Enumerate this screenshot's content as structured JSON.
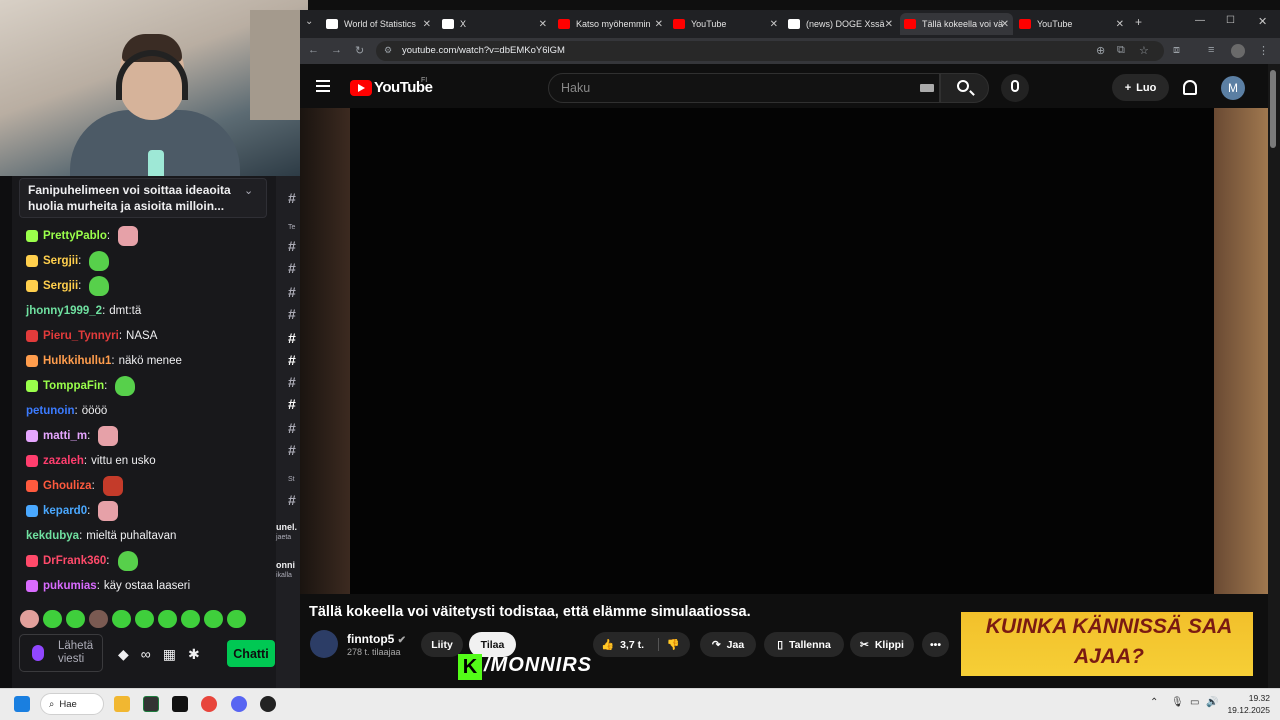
{
  "chat": {
    "pinned_message": "Fanipuhelimeen voi soittaa ideaoita huolia murheita ja asioita milloin...",
    "messages": [
      {
        "user": "PrettyPablo",
        "text": "",
        "color": "#9aff4b",
        "emote": "pink"
      },
      {
        "user": "Sergjii",
        "text": "",
        "color": "#ffcf4d",
        "emote": "green"
      },
      {
        "user": "Sergjii",
        "text": "",
        "color": "#ffcf4d",
        "emote": "green"
      },
      {
        "user": "jhonny1999_2",
        "text": "dmt:tä",
        "color": "#6fe0a0",
        "emote": ""
      },
      {
        "user": "Pieru_Tynnyri",
        "text": "NASA",
        "color": "#e23b3b",
        "emote": ""
      },
      {
        "user": "Hulkkihullu1",
        "text": "näkö menee",
        "color": "#ff9d4d",
        "emote": ""
      },
      {
        "user": "TomppaFin",
        "text": "",
        "color": "#9aff4b",
        "emote": "green"
      },
      {
        "user": "petunoin",
        "text": "öööö",
        "color": "#3b7bff",
        "emote": ""
      },
      {
        "user": "matti_m",
        "text": "",
        "color": "#e6a6ff",
        "emote": "pink"
      },
      {
        "user": "zazaleh",
        "text": "vittu en usko",
        "color": "#ff3e6e",
        "emote": ""
      },
      {
        "user": "Ghouliza",
        "text": "",
        "color": "#ff5a3e",
        "emote": "red"
      },
      {
        "user": "kepard0",
        "text": "",
        "color": "#4aa8ff",
        "emote": "pink"
      },
      {
        "user": "kekdubya",
        "text": "mieltä puhaltavan",
        "color": "#6fe0a0",
        "emote": ""
      },
      {
        "user": "DrFrank360",
        "text": "",
        "color": "#ff4a6a",
        "emote": "green"
      },
      {
        "user": "pukumias",
        "text": "käy ostaa laaseri",
        "color": "#d96bff",
        "emote": ""
      }
    ],
    "input_placeholder": "Lähetä viesti",
    "send_button": "Chatti",
    "side_column": {
      "label1": "unel.",
      "sub1": "jaeta",
      "label2": "onni",
      "sub2": "ikalla",
      "header1": "Te",
      "header2": "St"
    }
  },
  "browser": {
    "tabs": [
      {
        "title": "World of Statistics",
        "color": "#ffffff"
      },
      {
        "title": "X",
        "color": "#ffffff"
      },
      {
        "title": "Katso myöhemmin",
        "color": "#ff0000"
      },
      {
        "title": "YouTube",
        "color": "#ff0000"
      },
      {
        "title": "(news) DOGE Xssä",
        "color": "#ffffff"
      },
      {
        "title": "Tällä kokeella voi vä",
        "color": "#ff0000",
        "active": true
      },
      {
        "title": "YouTube",
        "color": "#ff0000"
      }
    ],
    "url": "youtube.com/watch?v=dbEMKoY6lGM"
  },
  "youtube": {
    "logo": "YouTube",
    "region": "FI",
    "search_placeholder": "Haku",
    "create_label": "Luo",
    "avatar_letter": "M",
    "video_title": "Tällä kokeella voi väitetysti todistaa, että elämme simulaatiossa.",
    "channel_name": "finntop5",
    "subscribers": "278 t. tilaajaa",
    "join_label": "Liity",
    "subscribe_label": "Tilaa",
    "likes": "3,7 t.",
    "share_label": "Jaa",
    "save_label": "Tallenna",
    "clip_label": "Klippi",
    "more_label": "•••",
    "overlay_text": "/MONNIRS",
    "overlay_k": "K",
    "recommended_thumb_text": "KUINKA KÄNNISSÄ SAA AJAA?"
  },
  "taskbar": {
    "search_label": "Hae",
    "time": "19.32",
    "date": "19.12.2025"
  }
}
